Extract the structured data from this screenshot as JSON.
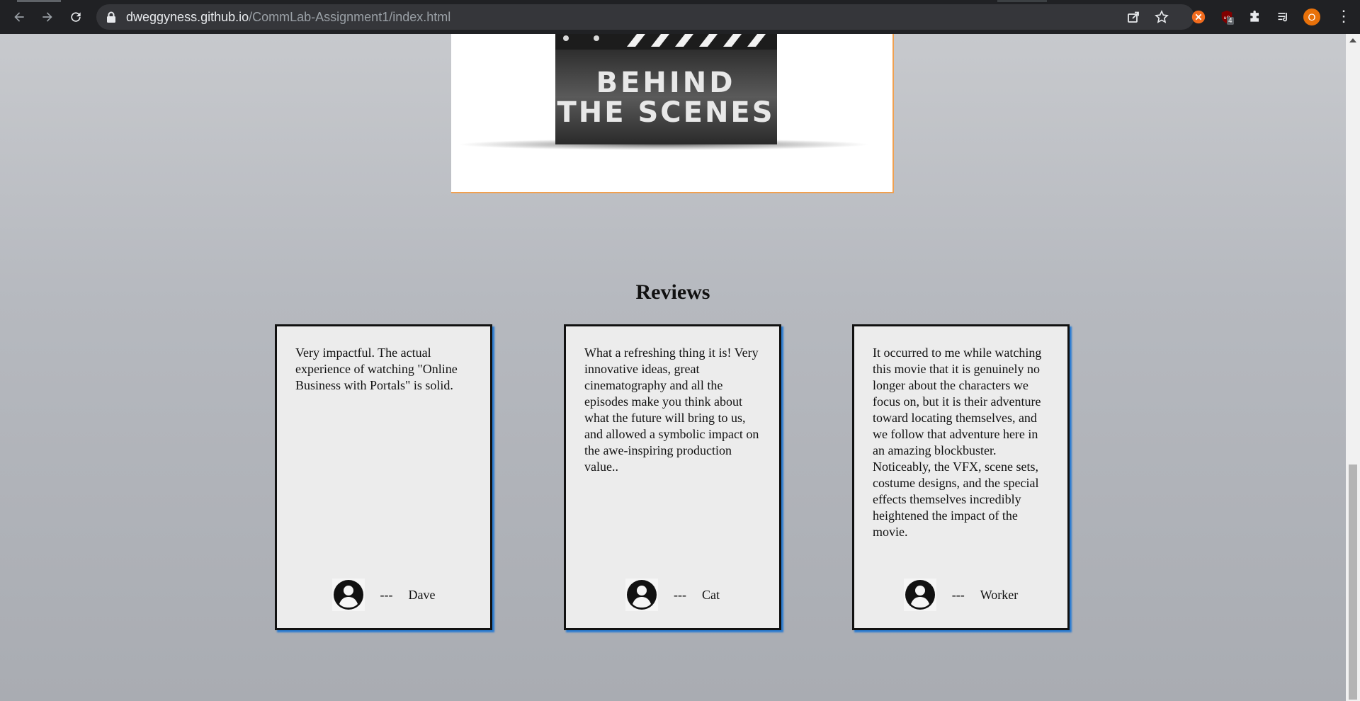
{
  "browser": {
    "url_domain": "dweggyness.github.io",
    "url_path": "/CommLab-Assignment1/index.html",
    "profile_initial": "O",
    "ublock_badge": "4"
  },
  "hero": {
    "image_text_line1": "BEHIND",
    "image_text_line2": "THE SCENES"
  },
  "reviews": {
    "title": "Reviews",
    "items": [
      {
        "text": "Very impactful. The actual experience of watching \"Online Business with Portals\" is solid.",
        "dashes": "---",
        "author": "Dave"
      },
      {
        "text": "What a refreshing thing it is! Very innovative ideas, great cinematography and all the episodes make you think about what the future will bring to us, and allowed a symbolic impact on the awe-inspiring production value..",
        "dashes": "---",
        "author": "Cat"
      },
      {
        "text": "It occurred to me while watching this movie that it is genuinely no longer about the characters we focus on, but it is their adventure toward locating themselves, and we follow that adventure here in an amazing blockbuster. Noticeably, the VFX, scene sets, costume designs, and the special effects themselves incredibly heightened the impact of the movie.",
        "dashes": "---",
        "author": "Worker"
      }
    ]
  }
}
